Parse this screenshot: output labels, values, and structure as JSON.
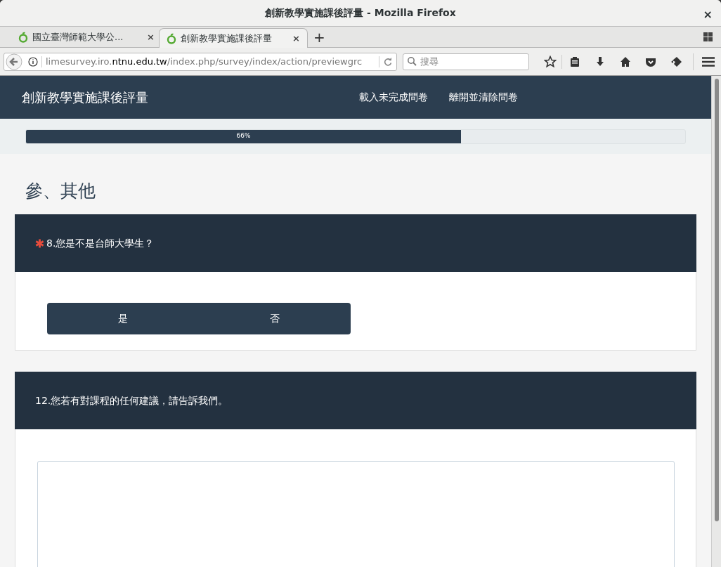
{
  "window": {
    "title": "創新教學實施課後評量 - Mozilla Firefox",
    "close": "×"
  },
  "tabs": [
    {
      "label": "國立臺灣師範大學公...",
      "close": "×",
      "selected": false
    },
    {
      "label": "創新教學實施課後評量",
      "close": "×",
      "selected": true
    }
  ],
  "new_tab": "+",
  "address_bar": {
    "prefix": "limesurvey.iro.",
    "domain": "ntnu.edu.tw",
    "path": "/index.php/survey/index/action/previewgrc"
  },
  "search": {
    "placeholder": "搜尋"
  },
  "site": {
    "title": "創新教學實施課後評量",
    "nav": [
      "載入未完成問卷",
      "離開並清除問卷"
    ]
  },
  "progress": {
    "level": 0.66,
    "label": "66%"
  },
  "section_title": "參、其他",
  "questions": [
    {
      "kind": "choice",
      "required": true,
      "text": "8.您是不是台師大學生？",
      "options": [
        {
          "label": "是",
          "selected": false
        },
        {
          "label": "否",
          "selected": false
        }
      ]
    },
    {
      "kind": "text",
      "required": false,
      "text": "12.您若有對課程的任何建議，請告訴我們。"
    }
  ]
}
